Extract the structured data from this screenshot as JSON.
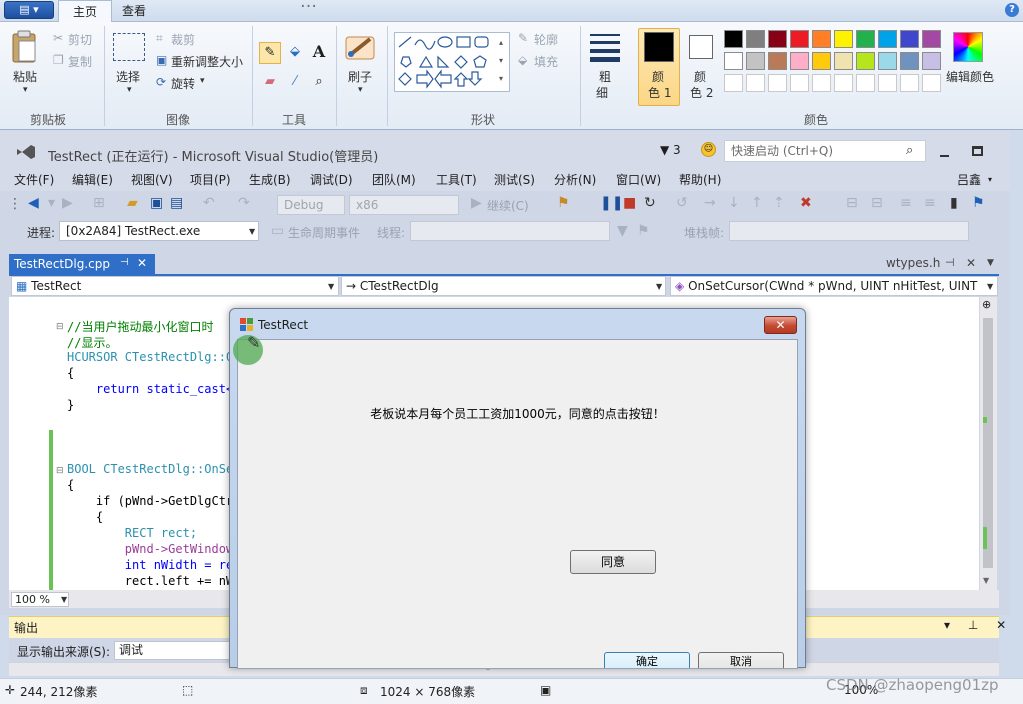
{
  "paint": {
    "app_menu_label": "▤ ▾",
    "tabs": [
      "主页",
      "查看"
    ],
    "window_title_partial": "…",
    "help_glyph": "?",
    "clipboard": {
      "paste": "粘贴",
      "cut": "剪切",
      "copy": "复制",
      "label": "剪贴板"
    },
    "image": {
      "select": "选择",
      "crop": "裁剪",
      "resize": "重新调整大小",
      "rotate": "旋转",
      "label": "图像"
    },
    "tools": {
      "label": "工具"
    },
    "brushes": {
      "label": "刷子"
    },
    "shapes": {
      "outline": "轮廓",
      "fill": "填充",
      "label": "形状"
    },
    "size": {
      "line1": "粗",
      "line2": "细"
    },
    "color1": {
      "line1": "颜",
      "line2": "色 1"
    },
    "color2": {
      "line1": "颜",
      "line2": "色 2"
    },
    "colors_label": "颜色",
    "edit_colors": "编辑颜色",
    "palette_row1": [
      "#000000",
      "#7f7f7f",
      "#880015",
      "#ed1c24",
      "#ff7f27",
      "#fff200",
      "#22b14c",
      "#00a2e8",
      "#3f48cc",
      "#a349a4"
    ],
    "palette_row2": [
      "#ffffff",
      "#c3c3c3",
      "#b97a57",
      "#ffaec9",
      "#ffc90e",
      "#efe4b0",
      "#b5e61d",
      "#99d9ea",
      "#7092be",
      "#c8bfe7"
    ],
    "status": {
      "cursor_pos": "244, 212像素",
      "canvas_size": "1024 × 768像素",
      "zoom": "100%"
    }
  },
  "vs": {
    "title": "TestRect (正在运行) - Microsoft Visual Studio(管理员)",
    "filter_count": "3",
    "quick_launch_placeholder": "快速启动 (Ctrl+Q)",
    "user_name": "吕鑫",
    "menu": [
      "文件(F)",
      "编辑(E)",
      "视图(V)",
      "项目(P)",
      "生成(B)",
      "调试(D)",
      "团队(M)",
      "工具(T)",
      "测试(S)",
      "分析(N)",
      "窗口(W)",
      "帮助(H)"
    ],
    "toolbar": {
      "config": "Debug",
      "platform": "x86",
      "continue": "继续(C)",
      "process_label": "进程:",
      "process_value": "[0x2A84] TestRect.exe",
      "lifecycle": "生命周期事件",
      "thread_label": "线程:",
      "stack_label": "堆栈帧:"
    },
    "doc_tab": "TestRectDlg.cpp",
    "doc_tab_right": "wtypes.h",
    "nav": {
      "project": "TestRect",
      "class": "→ CTestRectDlg",
      "member": "OnSetCursor(CWnd * pWnd, UINT nHitTest, UINT"
    },
    "code": [
      {
        "text": "//当用户拖动最小化窗口时",
        "cls": "c-green"
      },
      {
        "text": "//显示。",
        "cls": "c-green"
      },
      {
        "text": "HCURSOR CTestRectDlg::Q",
        "cls": "c-teal"
      },
      {
        "text": "{",
        "cls": "c-black"
      },
      {
        "text": "    return static_cast<",
        "cls": "c-blue"
      },
      {
        "text": "}",
        "cls": "c-black"
      },
      {
        "text": "",
        "cls": "c-black"
      },
      {
        "text": "",
        "cls": "c-black"
      },
      {
        "text": "BOOL CTestRectDlg::OnSe",
        "cls": "c-teal"
      },
      {
        "text": "{",
        "cls": "c-black"
      },
      {
        "text": "    if (pWnd->GetDlgCtr",
        "cls": "c-black"
      },
      {
        "text": "    {",
        "cls": "c-black"
      },
      {
        "text": "        RECT rect;",
        "cls": "c-teal"
      },
      {
        "text": "        pWnd->GetWindow",
        "cls": "c-purple"
      },
      {
        "text": "        int nWidth = re",
        "cls": "c-blue"
      },
      {
        "text": "        rect.left += nW",
        "cls": "c-black"
      }
    ],
    "zoom": "100 %",
    "output": {
      "title": "输出",
      "controls": "▾ ⊥ ✕",
      "source_label": "显示输出来源(S):",
      "source_value": "调试"
    }
  },
  "dialog": {
    "title": "TestRect",
    "close": "✕",
    "message": "老板说本月每个员工工资加1000元，同意的点击按钮！",
    "agree_button": "同意",
    "ok_button": "确定",
    "cancel_button": "取消"
  },
  "watermark": "CSDN @zhaopeng01zp"
}
